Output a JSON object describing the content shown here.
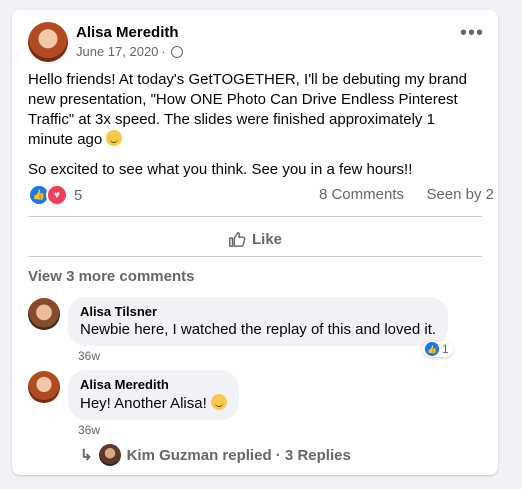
{
  "post": {
    "author": "Alisa Meredith",
    "date": "June 17, 2020",
    "separator": "·",
    "paragraph1": "Hello friends! At today's GetTOGETHER, I'll be debuting my brand new presentation, \"How ONE Photo Can Drive Endless Pinterest Traffic\" at 3x speed. The slides were finished approximately 1 minute ago",
    "paragraph2": "So excited to see what you think. See you in a few hours!!",
    "more_icon": "more-dots-icon",
    "privacy_icon": "group-icon"
  },
  "stats": {
    "reaction_count": "5",
    "comments": "8 Comments",
    "seen": "Seen by 2",
    "reaction_icons": [
      "like-icon",
      "love-icon"
    ]
  },
  "actions": {
    "like_label": "Like"
  },
  "comments_section": {
    "view_more": "View 3 more comments",
    "items": [
      {
        "name": "Alisa Tilsner",
        "text": "Newbie here, I watched the replay of this and loved it.",
        "time": "36w",
        "reaction_count": "1"
      },
      {
        "name": "Alisa Meredith",
        "text": "Hey! Another Alisa!",
        "time": "36w"
      }
    ],
    "replies": "Kim Guzman replied · 3 Replies"
  },
  "colors": {
    "accent": "#1877f2",
    "love": "#f33e58",
    "muted": "#65676b",
    "bubble": "#f0f2f5"
  }
}
